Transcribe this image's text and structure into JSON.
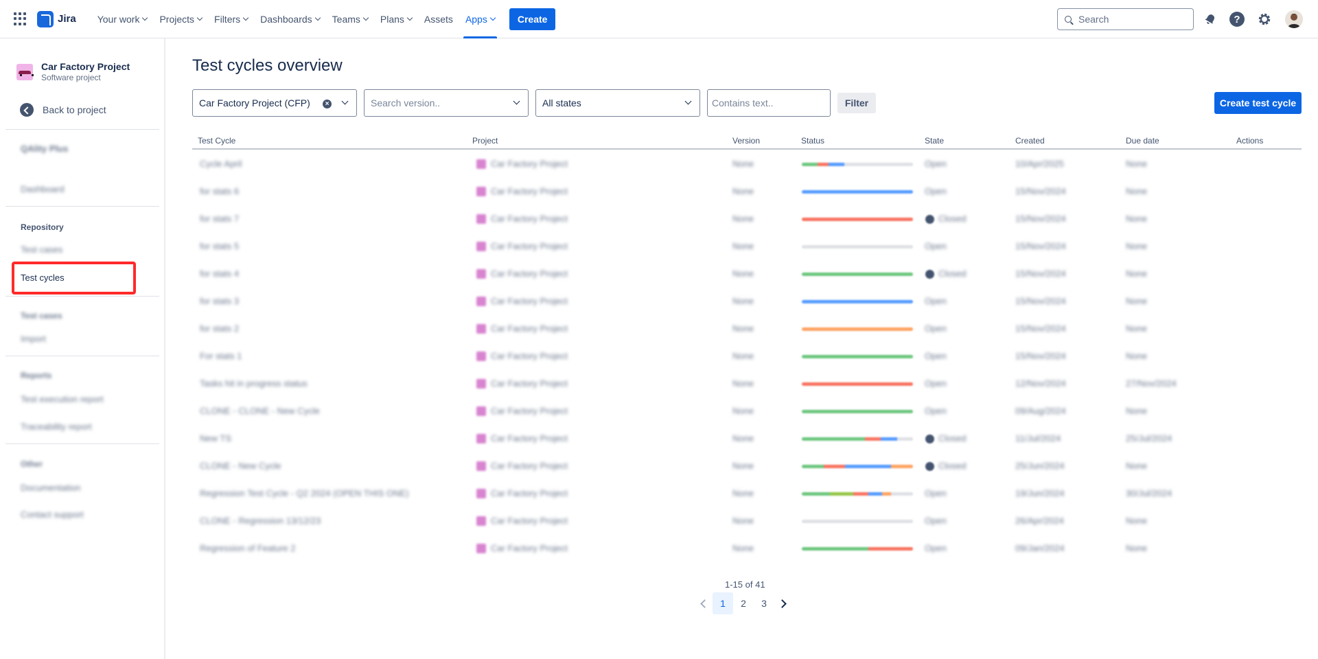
{
  "topnav": {
    "product": "Jira",
    "items": [
      {
        "label": "Your work"
      },
      {
        "label": "Projects"
      },
      {
        "label": "Filters"
      },
      {
        "label": "Dashboards"
      },
      {
        "label": "Teams"
      },
      {
        "label": "Plans"
      },
      {
        "label": "Assets"
      },
      {
        "label": "Apps"
      }
    ],
    "create_label": "Create",
    "search_placeholder": "Search",
    "accent_color": "#0c66e4"
  },
  "sidebar": {
    "project_name": "Car Factory Project",
    "project_type": "Software project",
    "back_label": "Back to project",
    "app_name": "QAlity Plus",
    "dashboard": "Dashboard",
    "repository_heading": "Repository",
    "test_cases": "Test cases",
    "test_cycles": "Test cycles",
    "test_cases_2": "Test cases",
    "import": "Import",
    "reports_heading": "Reports",
    "test_execution_report": "Test execution report",
    "traceability_report": "Traceability report",
    "other_heading": "Other",
    "documentation": "Documentation",
    "contact_support": "Contact support"
  },
  "main": {
    "title": "Test cycles overview",
    "filters": {
      "project_value": "Car Factory Project (CFP)",
      "version_placeholder": "Search version..",
      "state_value": "All states",
      "text_placeholder": "Contains text..",
      "filter_label": "Filter"
    },
    "create_cycle_label": "Create test cycle",
    "columns": [
      "Test Cycle",
      "Project",
      "Version",
      "Status",
      "State",
      "Created",
      "Due date",
      "Actions"
    ],
    "rows": [
      {
        "name": "Cycle April",
        "project": "Car Factory Project",
        "version": "None",
        "state": "Open",
        "created": "10/Apr/2025",
        "due": "None",
        "closed": false,
        "status": [
          [
            "#6ec77f",
            14
          ],
          [
            "#f87462",
            10
          ],
          [
            "#579dff",
            14
          ],
          [
            "#dfe1e6",
            62
          ]
        ]
      },
      {
        "name": "for stats 6",
        "project": "Car Factory Project",
        "version": "None",
        "state": "Open",
        "created": "15/Nov/2024",
        "due": "None",
        "closed": false,
        "status": [
          [
            "#579dff",
            100
          ]
        ]
      },
      {
        "name": "for stats 7",
        "project": "Car Factory Project",
        "version": "None",
        "state": "Closed",
        "created": "15/Nov/2024",
        "due": "None",
        "closed": true,
        "status": [
          [
            "#f87462",
            100
          ]
        ]
      },
      {
        "name": "for stats 5",
        "project": "Car Factory Project",
        "version": "None",
        "state": "Open",
        "created": "15/Nov/2024",
        "due": "None",
        "closed": false,
        "status": [
          [
            "#dfe1e6",
            100
          ]
        ]
      },
      {
        "name": "for stats 4",
        "project": "Car Factory Project",
        "version": "None",
        "state": "Closed",
        "created": "15/Nov/2024",
        "due": "None",
        "closed": true,
        "status": [
          [
            "#6ec77f",
            100
          ]
        ]
      },
      {
        "name": "for stats 3",
        "project": "Car Factory Project",
        "version": "None",
        "state": "Open",
        "created": "15/Nov/2024",
        "due": "None",
        "closed": false,
        "status": [
          [
            "#579dff",
            100
          ]
        ]
      },
      {
        "name": "for stats 2",
        "project": "Car Factory Project",
        "version": "None",
        "state": "Open",
        "created": "15/Nov/2024",
        "due": "None",
        "closed": false,
        "status": [
          [
            "#fea362",
            100
          ]
        ]
      },
      {
        "name": "For stats 1",
        "project": "Car Factory Project",
        "version": "None",
        "state": "Open",
        "created": "15/Nov/2024",
        "due": "None",
        "closed": false,
        "status": [
          [
            "#6ec77f",
            100
          ]
        ]
      },
      {
        "name": "Tasks hit in progress status",
        "project": "Car Factory Project",
        "version": "None",
        "state": "Open",
        "created": "12/Nov/2024",
        "due": "27/Nov/2024",
        "closed": false,
        "status": [
          [
            "#f87462",
            100
          ]
        ]
      },
      {
        "name": "CLONE - CLONE - New Cycle",
        "project": "Car Factory Project",
        "version": "None",
        "state": "Open",
        "created": "09/Aug/2024",
        "due": "None",
        "closed": false,
        "status": [
          [
            "#6ec77f",
            100
          ]
        ]
      },
      {
        "name": "New TS",
        "project": "Car Factory Project",
        "version": "None",
        "state": "Closed",
        "created": "11/Jul/2024",
        "due": "25/Jul/2024",
        "closed": true,
        "status": [
          [
            "#6ec77f",
            57
          ],
          [
            "#f87462",
            14
          ],
          [
            "#579dff",
            15
          ],
          [
            "#dfe1e6",
            14
          ]
        ]
      },
      {
        "name": "CLONE - New Cycle",
        "project": "Car Factory Project",
        "version": "None",
        "state": "Closed",
        "created": "25/Jun/2024",
        "due": "None",
        "closed": true,
        "status": [
          [
            "#6ec77f",
            20
          ],
          [
            "#f87462",
            19
          ],
          [
            "#579dff",
            41
          ],
          [
            "#fea362",
            20
          ]
        ]
      },
      {
        "name": "Regression Test Cycle - Q2 2024 (OPEN THIS ONE)",
        "project": "Car Factory Project",
        "version": "None",
        "state": "Open",
        "created": "19/Jun/2024",
        "due": "30/Jul/2024",
        "closed": false,
        "status": [
          [
            "#6ec77f",
            25
          ],
          [
            "#94c748",
            21
          ],
          [
            "#f87462",
            14
          ],
          [
            "#579dff",
            12
          ],
          [
            "#fea362",
            8
          ],
          [
            "#dfe1e6",
            20
          ]
        ]
      },
      {
        "name": "CLONE - Regression 13/12/23",
        "project": "Car Factory Project",
        "version": "None",
        "state": "Open",
        "created": "26/Apr/2024",
        "due": "None",
        "closed": false,
        "status": [
          [
            "#dfe1e6",
            100
          ]
        ]
      },
      {
        "name": "Regression of Feature 2",
        "project": "Car Factory Project",
        "version": "None",
        "state": "Open",
        "created": "09/Jan/2024",
        "due": "None",
        "closed": false,
        "status": [
          [
            "#6ec77f",
            60
          ],
          [
            "#f87462",
            40
          ]
        ]
      }
    ],
    "pagination": {
      "info": "1-15 of 41",
      "pages": [
        "1",
        "2",
        "3"
      ],
      "current": "1"
    }
  }
}
